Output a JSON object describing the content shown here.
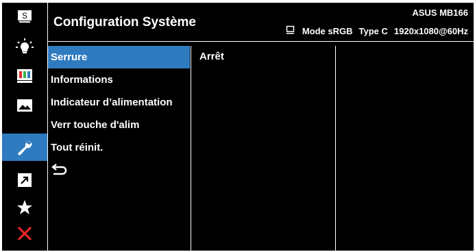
{
  "header": {
    "title": "Configuration Système",
    "model": "ASUS MB166",
    "mode": "Mode sRGB",
    "input": "Type C",
    "resolution": "1920x1080@60Hz"
  },
  "sidebar_icons": [
    {
      "name": "splendid-icon",
      "glyph": "S",
      "active": false
    },
    {
      "name": "blue-light-filter-icon",
      "active": false
    },
    {
      "name": "color-icon",
      "active": false
    },
    {
      "name": "image-icon",
      "active": false
    },
    {
      "name": "system-setup-icon",
      "active": true
    },
    {
      "name": "shortcut-icon",
      "active": false
    },
    {
      "name": "my-favorite-icon",
      "active": false
    },
    {
      "name": "close-icon",
      "active": false
    }
  ],
  "menu": {
    "items": [
      {
        "label": "Serrure",
        "selected": true
      },
      {
        "label": "Informations",
        "selected": false
      },
      {
        "label": "Indicateur d’alimentation",
        "selected": false
      },
      {
        "label": "Verr touche d'alim",
        "selected": false
      },
      {
        "label": "Tout réinit.",
        "selected": false
      }
    ],
    "back_icon": "back-arrow-icon"
  },
  "submenu": {
    "value": "Arrêt"
  },
  "colors": {
    "background": "#000000",
    "accent": "#2f7bc0",
    "text": "#ffffff",
    "close": "#e8262a"
  }
}
